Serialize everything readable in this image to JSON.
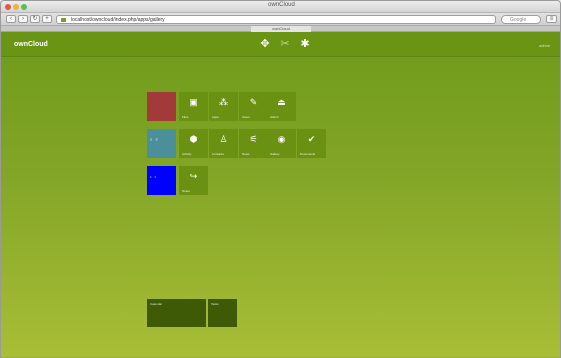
{
  "browser": {
    "window_title": "ownCloud",
    "tab_title": "ownCloud",
    "url": "localhost/owncloud/index.php/apps/gallery",
    "search_placeholder": "Google",
    "back_icon": "back-arrow-icon",
    "forward_icon": "forward-arrow-icon"
  },
  "app": {
    "brand": "ownCloud",
    "user": "admin",
    "header_icons": [
      "move-icon",
      "scissors-icon",
      "settings-icon"
    ]
  },
  "tiles": [
    {
      "label": "",
      "color": "#a33a3a"
    },
    {
      "label": "Files",
      "icon": "image-icon",
      "glyph": "▣"
    },
    {
      "label": "Apps",
      "icon": "network-icon",
      "glyph": "⁂"
    },
    {
      "label": "Users",
      "icon": "wrench-icon",
      "glyph": "✎"
    },
    {
      "label": "Admin",
      "icon": "tray-icon",
      "glyph": "⏏"
    },
    {
      "label": "",
      "color": "#4a8f9a",
      "glyph": "≡ ≡"
    },
    {
      "label": "Activity",
      "icon": "apple-icon",
      "glyph": "⬢"
    },
    {
      "label": "Contacts",
      "icon": "people-icon",
      "glyph": "♙"
    },
    {
      "label": "News",
      "icon": "rss-icon",
      "glyph": "⚟"
    },
    {
      "label": "Gallery",
      "icon": "target-icon",
      "glyph": "◉"
    },
    {
      "label": "Documents",
      "icon": "lightbulb-icon",
      "glyph": "✔"
    },
    {
      "label": "",
      "color": "#0000ff",
      "glyph": "• •"
    },
    {
      "label": "Notes",
      "icon": "share-icon",
      "glyph": "↪"
    }
  ],
  "dock": [
    {
      "label": "Calendar"
    },
    {
      "label": "Tasks"
    }
  ],
  "colors": {
    "app_green": "#6a9413",
    "tile_green": "#6b9112",
    "dock_dark": "#3e5a06"
  }
}
